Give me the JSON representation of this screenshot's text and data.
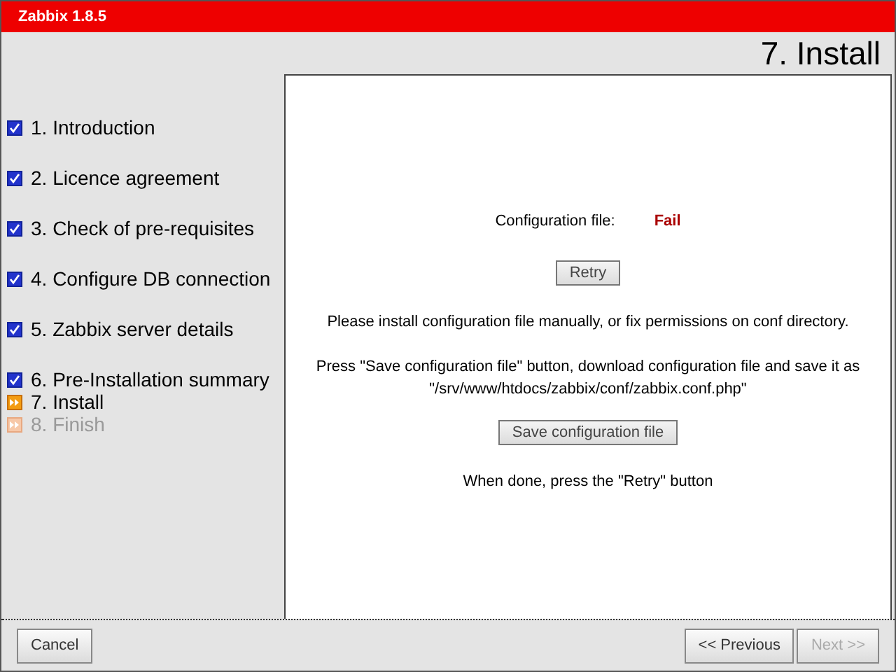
{
  "header": {
    "title": "Zabbix 1.8.5"
  },
  "page_title": "7. Install",
  "steps": [
    {
      "label": "1. Introduction",
      "kind": "done"
    },
    {
      "label": "2. Licence agreement",
      "kind": "done"
    },
    {
      "label": "3. Check of pre-requisites",
      "kind": "done"
    },
    {
      "label": "4. Configure DB connection",
      "kind": "done"
    },
    {
      "label": "5. Zabbix server details",
      "kind": "done"
    },
    {
      "label": "6. Pre-Installation summary",
      "kind": "done"
    },
    {
      "label": "7. Install",
      "kind": "current"
    },
    {
      "label": "8. Finish",
      "kind": "pending"
    }
  ],
  "content": {
    "status_label": "Configuration file:",
    "status_value": "Fail",
    "retry_button": "Retry",
    "message": "Please install configuration file manually, or fix permissions on conf directory.",
    "instructions": [
      "Press \"Save configuration file\" button, download configuration file and save it as",
      "\"/srv/www/htdocs/zabbix/conf/zabbix.conf.php\""
    ],
    "save_button": "Save configuration file",
    "done_note": "When done, press the \"Retry\" button"
  },
  "footer": {
    "cancel": {
      "label": "Cancel",
      "disabled": false
    },
    "previous": {
      "label": "<< Previous",
      "disabled": false
    },
    "next": {
      "label": "Next >>",
      "disabled": true
    }
  }
}
